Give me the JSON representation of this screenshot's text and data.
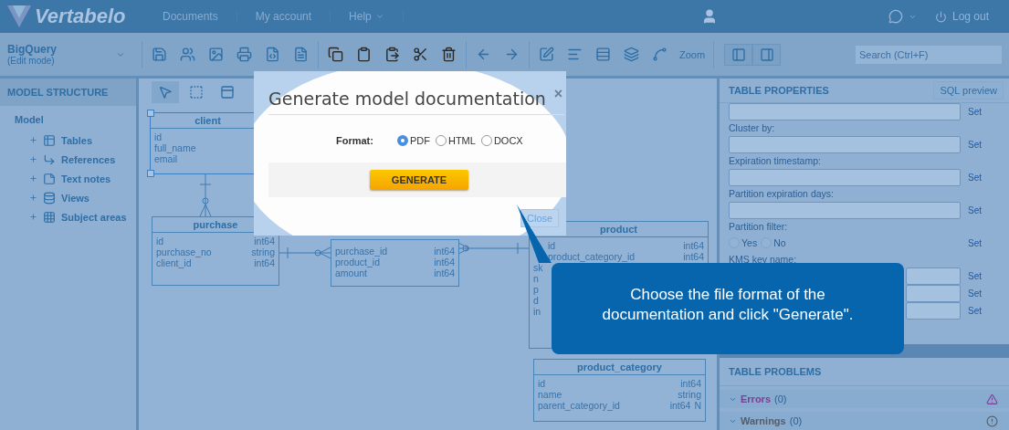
{
  "header": {
    "logo": "Vertabelo",
    "nav": [
      {
        "label": "Documents",
        "dropdown": false
      },
      {
        "label": "My account",
        "dropdown": false
      },
      {
        "label": "Help",
        "dropdown": true
      }
    ],
    "logout": "Log out"
  },
  "toolbar": {
    "model_name": "BigQuery",
    "mode": "(Edit mode)",
    "zoom": "Zoom",
    "search": {
      "placeholder": "Search (Ctrl+F)"
    }
  },
  "sidebar": {
    "title": "MODEL STRUCTURE",
    "tree": {
      "label": "Model",
      "children": [
        {
          "label": "Tables",
          "kind": "tables"
        },
        {
          "label": "References",
          "kind": "references"
        },
        {
          "label": "Text notes",
          "kind": "notes"
        },
        {
          "label": "Views",
          "kind": "views"
        },
        {
          "label": "Subject areas",
          "kind": "areas"
        }
      ]
    }
  },
  "diagram": {
    "tables": [
      {
        "name": "client",
        "selected": true,
        "columns": [
          {
            "name": "id"
          },
          {
            "name": "full_name"
          },
          {
            "name": "email"
          }
        ]
      },
      {
        "name": "purchase",
        "selected": false,
        "columns": [
          {
            "name": "id",
            "type": "int64"
          },
          {
            "name": "purchase_no",
            "type": "string"
          },
          {
            "name": "client_id",
            "type": "int64"
          }
        ]
      },
      {
        "selected": false,
        "columns": [
          {
            "name": "purchase_id",
            "type": "int64"
          },
          {
            "name": "product_id",
            "type": "int64"
          },
          {
            "name": "amount",
            "type": "int64"
          }
        ]
      },
      {
        "name": "product",
        "selected": false,
        "columns": [
          {
            "name": "id",
            "type": "int64"
          },
          {
            "name": "product_category_id",
            "type": "int64"
          },
          {
            "name": "sk"
          },
          {
            "name": "n"
          },
          {
            "name": "p"
          },
          {
            "name": "d"
          },
          {
            "name": "in"
          }
        ]
      },
      {
        "name": "product_category",
        "selected": false,
        "columns": [
          {
            "name": "id",
            "type": "int64"
          },
          {
            "name": "name",
            "type": "string"
          },
          {
            "name": "parent_category_id",
            "type": "int64",
            "flag": "N"
          }
        ]
      }
    ]
  },
  "properties": {
    "title": "TABLE PROPERTIES",
    "sql_preview": "SQL preview",
    "fields": [
      {
        "kind": "field",
        "set": "Set"
      },
      {
        "kind": "field",
        "label": "Cluster by:",
        "set": "Set"
      },
      {
        "kind": "field",
        "label": "Expiration timestamp:",
        "set": "Set"
      },
      {
        "kind": "field",
        "label": "Partition expiration days:",
        "set": "Set"
      },
      {
        "kind": "radio",
        "label": "Partition filter:",
        "options": [
          {
            "label": "Yes",
            "selected": false
          },
          {
            "label": "No",
            "selected": false
          }
        ],
        "set": "Set"
      },
      {
        "kind": "field",
        "label": "KMS key name:",
        "set": "Set"
      },
      {
        "kind": "field",
        "set": "Set"
      },
      {
        "kind": "field",
        "set": "Set"
      }
    ]
  },
  "problems": {
    "title": "TABLE PROBLEMS",
    "sections": [
      {
        "kind": "error",
        "label": "Errors",
        "count": "(0)"
      },
      {
        "kind": "warning",
        "label": "Warnings",
        "count": "(0)"
      }
    ]
  },
  "dialog": {
    "title": "Generate model documentation",
    "close_icon": "×",
    "format_label": "Format:",
    "formats": [
      {
        "label": "PDF",
        "selected": true
      },
      {
        "label": "HTML",
        "selected": false
      },
      {
        "label": "DOCX",
        "selected": false
      }
    ],
    "generate": "GENERATE",
    "close_button": "Close"
  },
  "callout": {
    "text": "Choose the file format of the documentation and click \"Generate\"."
  }
}
